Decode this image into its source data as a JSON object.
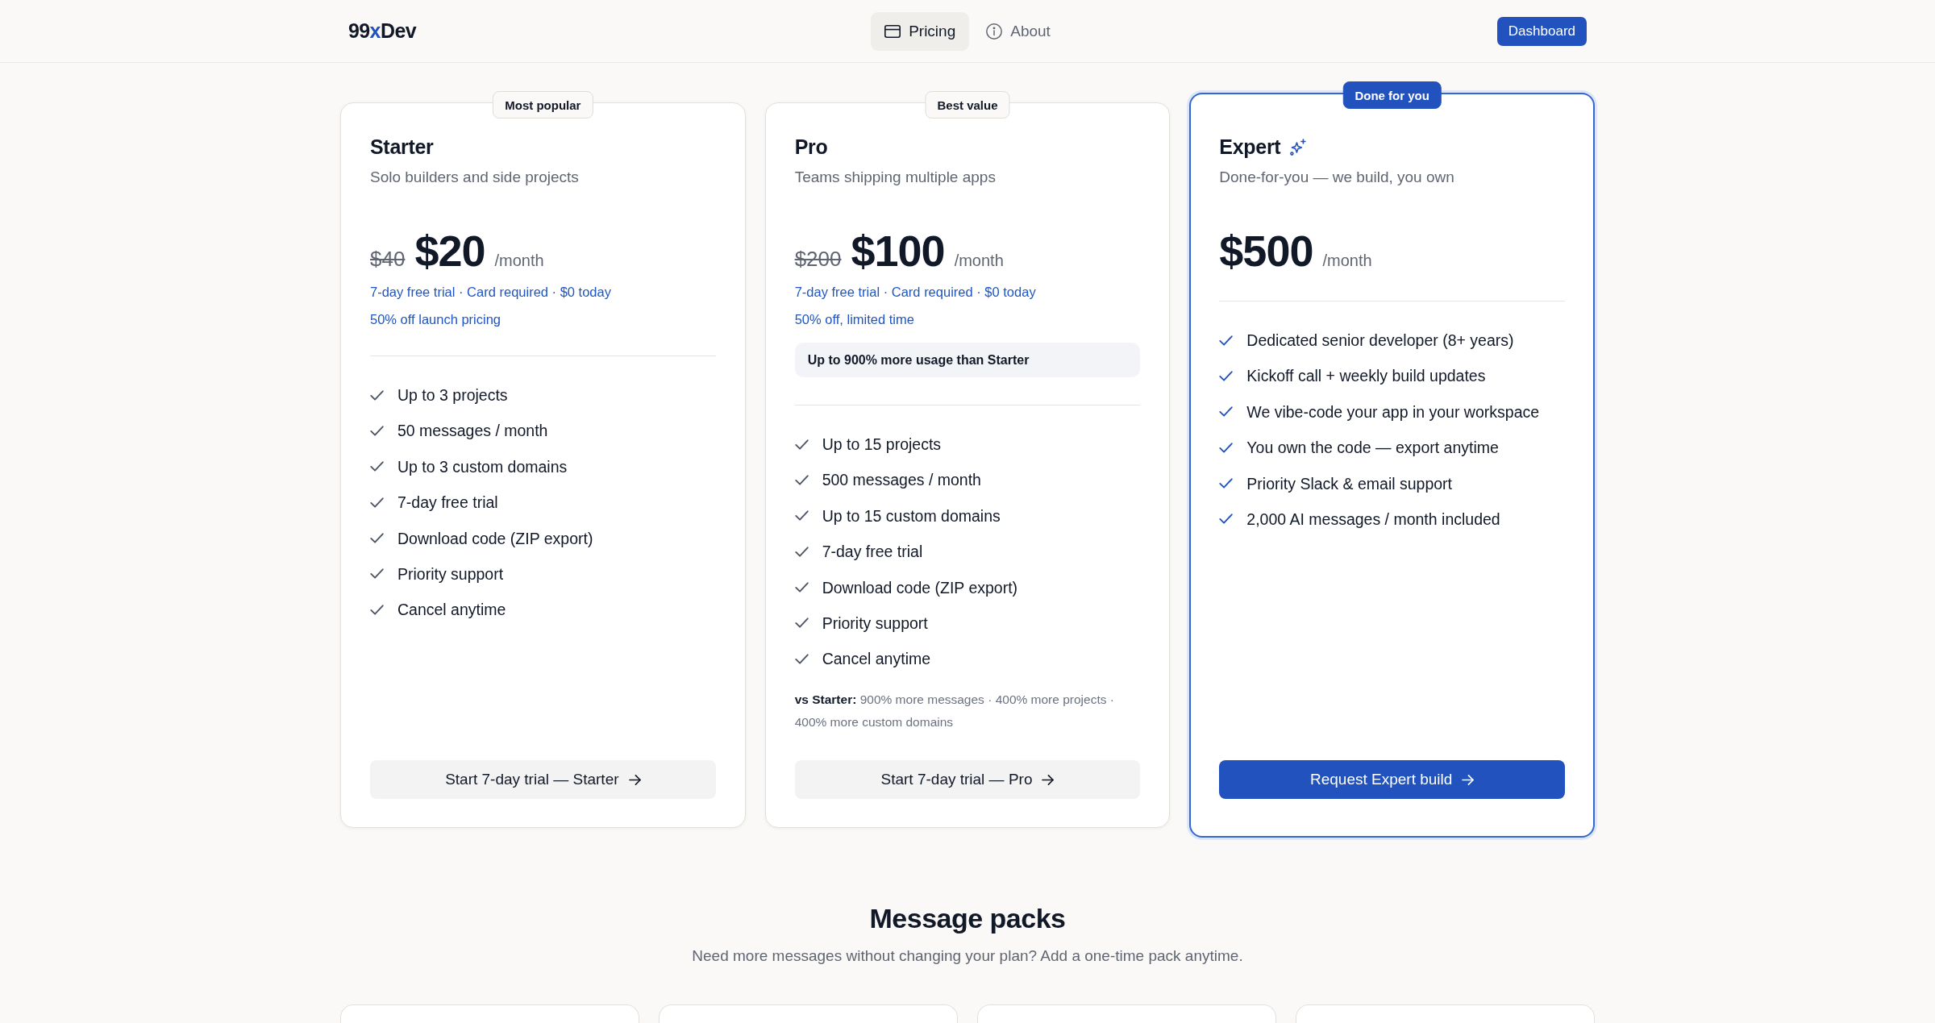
{
  "header": {
    "logo": [
      {
        "text": "99",
        "accent": false
      },
      {
        "text": "x",
        "accent": true
      },
      {
        "text": "Dev",
        "accent": false
      }
    ],
    "nav": [
      {
        "label": "Pricing",
        "selected": true
      },
      {
        "label": "About",
        "selected": false
      }
    ],
    "dashboard_button": "Dashboard"
  },
  "plans": [
    {
      "badge": "Most popular",
      "featured": false,
      "name": "Starter",
      "tagline": "Solo builders and side projects",
      "old_price": "$40",
      "price": "$20",
      "period": "/month",
      "notes": [
        "7-day free trial · Card required · $0 today",
        "50% off launch pricing"
      ],
      "features": [
        "Up to 3 projects",
        "50 messages / month",
        "Up to 3 custom domains",
        "7-day free trial",
        "Download code (ZIP export)",
        "Priority support",
        "Cancel anytime"
      ],
      "cta": "Start 7-day trial — Starter"
    },
    {
      "badge": "Best value",
      "featured": false,
      "name": "Pro",
      "tagline": "Teams shipping multiple apps",
      "old_price": "$200",
      "price": "$100",
      "period": "/month",
      "notes": [
        "7-day free trial · Card required · $0 today",
        "50% off, limited time"
      ],
      "highlight": "Up to 900% more usage than Starter",
      "features": [
        "Up to 15 projects",
        "500 messages / month",
        "Up to 15 custom domains",
        "7-day free trial",
        "Download code (ZIP export)",
        "Priority support",
        "Cancel anytime"
      ],
      "comparison": "**vs Starter:** 900% more messages · 400% more projects · 400% more custom domains",
      "cta": "Start 7-day trial — Pro"
    },
    {
      "badge": "Done for you",
      "featured": true,
      "name": "Expert",
      "tagline": "Done-for-you — we build, you own",
      "price": "$500",
      "period": "/month",
      "features": [
        "Dedicated senior developer (8+ years)",
        "Kickoff call + weekly build updates",
        "We vibe-code your app in your workspace",
        "You own the code — export anytime",
        "Priority Slack & email support",
        "2,000 AI messages / month included"
      ],
      "cta": "Request Expert build"
    }
  ],
  "message_packs": {
    "title": "Message packs",
    "subtitle": "Need more messages without changing your plan? Add a one-time pack anytime."
  }
}
